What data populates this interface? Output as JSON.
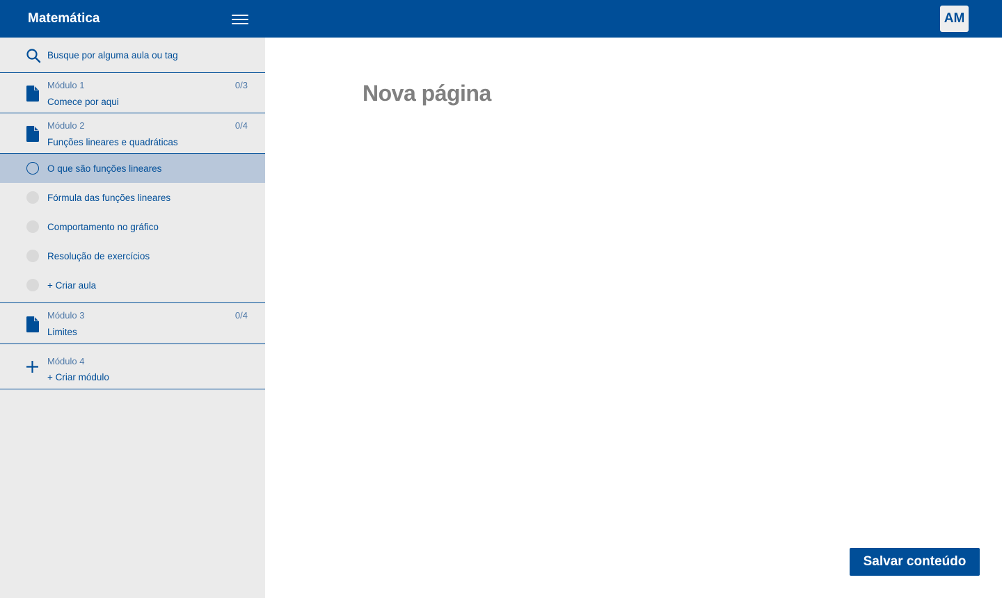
{
  "header": {
    "title": "Matemática",
    "menu_icon": "hamburger-icon",
    "avatar_initials": "AM",
    "bg_color": "#004E98"
  },
  "sidebar": {
    "search": {
      "placeholder": "Busque por alguma aula ou tag",
      "icon": "search-icon"
    },
    "modules": [
      {
        "number": "Módulo 1",
        "title": "Comece por aqui",
        "progress": "0/3",
        "icon": "document-icon"
      },
      {
        "number": "Módulo 2",
        "title": "Funções lineares e quadráticas",
        "progress": "0/4",
        "icon": "document-icon"
      },
      {
        "number": "Módulo 3",
        "title": "Limites",
        "progress": "0/4",
        "icon": "document-icon"
      },
      {
        "number": "Módulo 4",
        "title": "+ Criar módulo",
        "icon": "plus-icon"
      }
    ],
    "lessons": [
      {
        "label": "O que são funções lineares",
        "active": true
      },
      {
        "label": "Fórmula das funções lineares",
        "active": false
      },
      {
        "label": "Comportamento no gráfico",
        "active": false
      },
      {
        "label": "Resolução de exercícios",
        "active": false
      },
      {
        "label": "+ Criar aula",
        "active": false
      }
    ]
  },
  "main": {
    "title": "Nova página",
    "save_label": "Salvar conteúdo"
  },
  "colors": {
    "primary": "#004E98",
    "sidebar_bg": "#EBEBEB",
    "active_lesson_bg": "#B8C7DA",
    "title_gray": "#808080"
  }
}
